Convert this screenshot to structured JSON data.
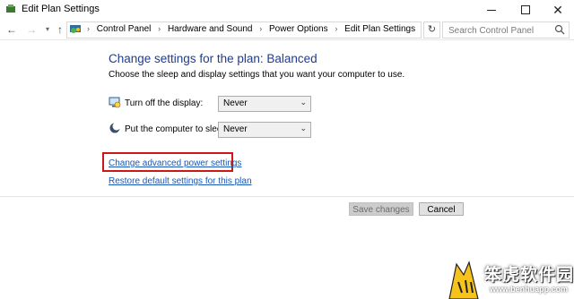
{
  "window": {
    "title": "Edit Plan Settings"
  },
  "address_bar": {
    "breadcrumbs": [
      "Control Panel",
      "Hardware and Sound",
      "Power Options",
      "Edit Plan Settings"
    ],
    "search_placeholder": "Search Control Panel"
  },
  "content": {
    "heading": "Change settings for the plan: Balanced",
    "subtitle": "Choose the sleep and display settings that you want your computer to use.",
    "settings": [
      {
        "label": "Turn off the display:",
        "value": "Never",
        "icon": "monitor-icon"
      },
      {
        "label": "Put the computer to sleep:",
        "value": "Never",
        "icon": "moon-sleep-icon"
      }
    ],
    "links": {
      "advanced": "Change advanced power settings",
      "restore": "Restore default settings for this plan"
    },
    "highlight_color": "#cc1717"
  },
  "buttons": {
    "save": "Save changes",
    "save_enabled": false,
    "cancel": "Cancel"
  },
  "watermark": {
    "text": "笨虎软件园",
    "url": "www.benhuapp.com"
  }
}
